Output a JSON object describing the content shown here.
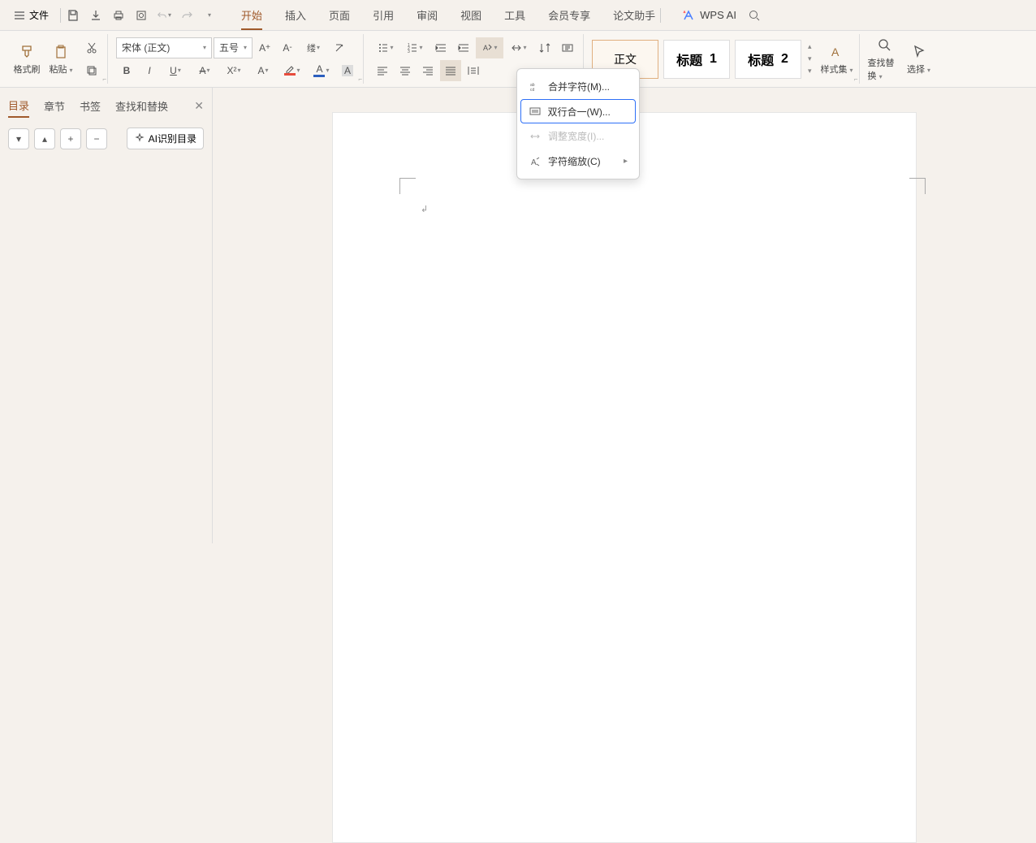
{
  "topbar": {
    "file_label": "文件",
    "tabs": [
      "开始",
      "插入",
      "页面",
      "引用",
      "审阅",
      "视图",
      "工具",
      "会员专享",
      "论文助手"
    ],
    "active_tab": 0,
    "wpsai_label": "WPS AI"
  },
  "ribbon": {
    "format_painter": "格式刷",
    "paste": "粘贴",
    "font_name": "宋体 (正文)",
    "font_size": "五号",
    "styles": {
      "body": "正文",
      "h1_prefix": "标题",
      "h1_num": "1",
      "h2_prefix": "标题",
      "h2_num": "2"
    },
    "style_set": "样式集",
    "find_replace": "查找替换",
    "select": "选择"
  },
  "sidepanel": {
    "tabs": [
      "目录",
      "章节",
      "书签",
      "查找和替换"
    ],
    "active": 0,
    "ai_btn": "AI识别目录"
  },
  "dropdown": {
    "merge_chars": "合并字符(M)...",
    "two_lines": "双行合一(W)...",
    "adjust_width": "调整宽度(I)...",
    "char_scale": "字符缩放(C)"
  }
}
